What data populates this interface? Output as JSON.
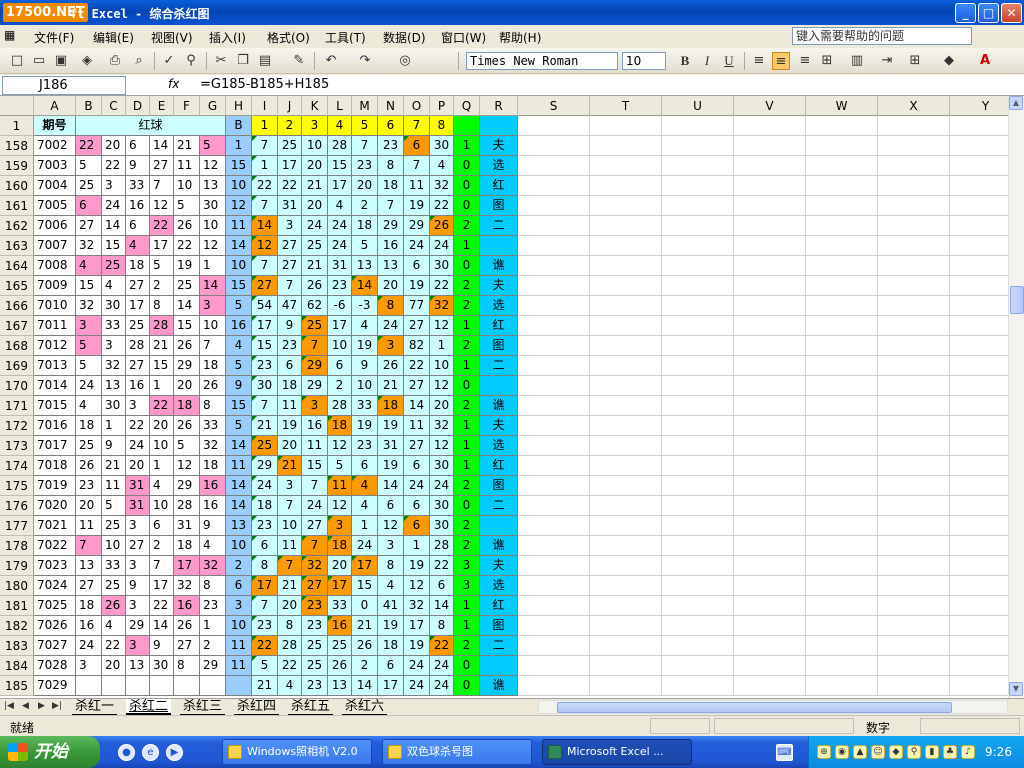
{
  "window": {
    "logo": "17500.NET",
    "title": "ft Excel - 综合杀红图",
    "min": "_",
    "max": "□",
    "close": "✕"
  },
  "menu": [
    "文件(F)",
    "编辑(E)",
    "视图(V)",
    "插入(I)",
    "格式(O)",
    "工具(T)",
    "数据(D)",
    "窗口(W)",
    "帮助(H)"
  ],
  "help_placeholder": "键入需要帮助的问题",
  "font": {
    "family_label": "Times New Roman",
    "size": "10"
  },
  "formula_bar": {
    "name_box": "J186",
    "fx": "fx",
    "formula": "=G185-B185+H185"
  },
  "columns": [
    "A",
    "B",
    "C",
    "D",
    "E",
    "F",
    "G",
    "H",
    "I",
    "J",
    "K",
    "L",
    "M",
    "N",
    "O",
    "P",
    "Q",
    "R",
    "S",
    "T",
    "U",
    "V",
    "W",
    "X",
    "Y"
  ],
  "header_row": {
    "row_num": "1",
    "period_label": "期号",
    "red_label": "红球",
    "blue_label": "B",
    "kill_nums": [
      "1",
      "2",
      "3",
      "4",
      "5",
      "6",
      "7",
      "8"
    ]
  },
  "rows": [
    {
      "n": "158",
      "p": "7002",
      "r": [
        "22",
        "20",
        "6",
        "14",
        "21",
        "5"
      ],
      "b": "1",
      "k": [
        "7",
        "25",
        "10",
        "28",
        "7",
        "23",
        "6",
        "30"
      ],
      "q": "1",
      "t": "夫",
      "hl": [
        0,
        5
      ],
      "or": [
        6
      ]
    },
    {
      "n": "159",
      "p": "7003",
      "r": [
        "5",
        "22",
        "9",
        "27",
        "11",
        "12"
      ],
      "b": "15",
      "k": [
        "1",
        "17",
        "20",
        "15",
        "23",
        "8",
        "7",
        "4"
      ],
      "q": "0",
      "t": "选",
      "hl": [],
      "or": []
    },
    {
      "n": "160",
      "p": "7004",
      "r": [
        "25",
        "3",
        "33",
        "7",
        "10",
        "13"
      ],
      "b": "10",
      "k": [
        "22",
        "22",
        "21",
        "17",
        "20",
        "18",
        "11",
        "32"
      ],
      "q": "0",
      "t": "红",
      "hl": [],
      "or": []
    },
    {
      "n": "161",
      "p": "7005",
      "r": [
        "6",
        "24",
        "16",
        "12",
        "5",
        "30"
      ],
      "b": "12",
      "k": [
        "7",
        "31",
        "20",
        "4",
        "2",
        "7",
        "19",
        "22"
      ],
      "q": "0",
      "t": "图",
      "hl": [
        0
      ],
      "or": []
    },
    {
      "n": "162",
      "p": "7006",
      "r": [
        "27",
        "14",
        "6",
        "22",
        "26",
        "10"
      ],
      "b": "11",
      "k": [
        "14",
        "3",
        "24",
        "24",
        "18",
        "29",
        "29",
        "26"
      ],
      "q": "2",
      "t": "二",
      "hl": [
        3
      ],
      "or": [
        0,
        7
      ]
    },
    {
      "n": "163",
      "p": "7007",
      "r": [
        "32",
        "15",
        "4",
        "17",
        "22",
        "12"
      ],
      "b": "14",
      "k": [
        "12",
        "27",
        "25",
        "24",
        "5",
        "16",
        "24",
        "24"
      ],
      "q": "1",
      "t": "",
      "hl": [
        2
      ],
      "or": [
        0
      ]
    },
    {
      "n": "164",
      "p": "7008",
      "r": [
        "4",
        "25",
        "18",
        "5",
        "19",
        "1"
      ],
      "b": "10",
      "k": [
        "7",
        "27",
        "21",
        "31",
        "13",
        "13",
        "6",
        "30"
      ],
      "q": "0",
      "t": "谯",
      "hl": [
        0,
        1
      ],
      "or": []
    },
    {
      "n": "165",
      "p": "7009",
      "r": [
        "15",
        "4",
        "27",
        "2",
        "25",
        "14"
      ],
      "b": "15",
      "k": [
        "27",
        "7",
        "26",
        "23",
        "14",
        "20",
        "19",
        "22"
      ],
      "q": "2",
      "t": "夫",
      "hl": [
        5
      ],
      "or": [
        0,
        4
      ]
    },
    {
      "n": "166",
      "p": "7010",
      "r": [
        "32",
        "30",
        "17",
        "8",
        "14",
        "3"
      ],
      "b": "5",
      "k": [
        "54",
        "47",
        "62",
        "-6",
        "-3",
        "8",
        "77",
        "32"
      ],
      "q": "2",
      "t": "选",
      "hl": [
        5
      ],
      "or": [
        5,
        7
      ]
    },
    {
      "n": "167",
      "p": "7011",
      "r": [
        "3",
        "33",
        "25",
        "28",
        "15",
        "10"
      ],
      "b": "16",
      "k": [
        "17",
        "9",
        "25",
        "17",
        "4",
        "24",
        "27",
        "12"
      ],
      "q": "1",
      "t": "红",
      "hl": [
        0,
        3
      ],
      "or": [
        2
      ]
    },
    {
      "n": "168",
      "p": "7012",
      "r": [
        "5",
        "3",
        "28",
        "21",
        "26",
        "7"
      ],
      "b": "4",
      "k": [
        "15",
        "23",
        "7",
        "10",
        "19",
        "3",
        "82",
        "1"
      ],
      "q": "2",
      "t": "图",
      "hl": [
        0
      ],
      "or": [
        2,
        5
      ]
    },
    {
      "n": "169",
      "p": "7013",
      "r": [
        "5",
        "32",
        "27",
        "15",
        "29",
        "18"
      ],
      "b": "5",
      "k": [
        "23",
        "6",
        "29",
        "6",
        "9",
        "26",
        "22",
        "10"
      ],
      "q": "1",
      "t": "二",
      "hl": [],
      "or": [
        2
      ]
    },
    {
      "n": "170",
      "p": "7014",
      "r": [
        "24",
        "13",
        "16",
        "1",
        "20",
        "26"
      ],
      "b": "9",
      "k": [
        "30",
        "18",
        "29",
        "2",
        "10",
        "21",
        "27",
        "12"
      ],
      "q": "0",
      "t": "",
      "hl": [],
      "or": []
    },
    {
      "n": "171",
      "p": "7015",
      "r": [
        "4",
        "30",
        "3",
        "22",
        "18",
        "8"
      ],
      "b": "15",
      "k": [
        "7",
        "11",
        "3",
        "28",
        "33",
        "18",
        "14",
        "20"
      ],
      "q": "2",
      "t": "谯",
      "hl": [
        3,
        4
      ],
      "or": [
        2,
        5
      ]
    },
    {
      "n": "172",
      "p": "7016",
      "r": [
        "18",
        "1",
        "22",
        "20",
        "26",
        "33"
      ],
      "b": "5",
      "k": [
        "21",
        "19",
        "16",
        "18",
        "19",
        "19",
        "11",
        "32"
      ],
      "q": "1",
      "t": "夫",
      "hl": [],
      "or": [
        3
      ]
    },
    {
      "n": "173",
      "p": "7017",
      "r": [
        "25",
        "9",
        "24",
        "10",
        "5",
        "32"
      ],
      "b": "14",
      "k": [
        "25",
        "20",
        "11",
        "12",
        "23",
        "31",
        "27",
        "12"
      ],
      "q": "1",
      "t": "选",
      "hl": [],
      "or": [
        0
      ]
    },
    {
      "n": "174",
      "p": "7018",
      "r": [
        "26",
        "21",
        "20",
        "1",
        "12",
        "18"
      ],
      "b": "11",
      "k": [
        "29",
        "21",
        "15",
        "5",
        "6",
        "19",
        "6",
        "30"
      ],
      "q": "1",
      "t": "红",
      "hl": [],
      "or": [
        1
      ]
    },
    {
      "n": "175",
      "p": "7019",
      "r": [
        "23",
        "11",
        "31",
        "4",
        "29",
        "16"
      ],
      "b": "14",
      "k": [
        "24",
        "3",
        "7",
        "11",
        "4",
        "14",
        "24",
        "24"
      ],
      "q": "2",
      "t": "图",
      "hl": [
        2,
        5
      ],
      "or": [
        3,
        4
      ]
    },
    {
      "n": "176",
      "p": "7020",
      "r": [
        "20",
        "5",
        "31",
        "10",
        "28",
        "16"
      ],
      "b": "14",
      "k": [
        "18",
        "7",
        "24",
        "12",
        "4",
        "6",
        "6",
        "30"
      ],
      "q": "0",
      "t": "二",
      "hl": [
        2
      ],
      "or": []
    },
    {
      "n": "177",
      "p": "7021",
      "r": [
        "11",
        "25",
        "3",
        "6",
        "31",
        "9"
      ],
      "b": "13",
      "k": [
        "23",
        "10",
        "27",
        "3",
        "1",
        "12",
        "6",
        "30"
      ],
      "q": "2",
      "t": "",
      "hl": [],
      "or": [
        3,
        6
      ]
    },
    {
      "n": "178",
      "p": "7022",
      "r": [
        "7",
        "10",
        "27",
        "2",
        "18",
        "4"
      ],
      "b": "10",
      "k": [
        "6",
        "11",
        "7",
        "18",
        "24",
        "3",
        "1",
        "28"
      ],
      "q": "2",
      "t": "谯",
      "hl": [
        0
      ],
      "or": [
        2,
        3
      ]
    },
    {
      "n": "179",
      "p": "7023",
      "r": [
        "13",
        "33",
        "3",
        "7",
        "17",
        "32"
      ],
      "b": "2",
      "k": [
        "8",
        "7",
        "32",
        "20",
        "17",
        "8",
        "19",
        "22"
      ],
      "q": "3",
      "t": "夫",
      "hl": [
        4,
        5
      ],
      "or": [
        1,
        2,
        4
      ]
    },
    {
      "n": "180",
      "p": "7024",
      "r": [
        "27",
        "25",
        "9",
        "17",
        "32",
        "8"
      ],
      "b": "6",
      "k": [
        "17",
        "21",
        "27",
        "17",
        "15",
        "4",
        "12",
        "6"
      ],
      "q": "3",
      "t": "选",
      "hl": [],
      "or": [
        0,
        2,
        3
      ]
    },
    {
      "n": "181",
      "p": "7025",
      "r": [
        "18",
        "26",
        "3",
        "22",
        "16",
        "23"
      ],
      "b": "3",
      "k": [
        "7",
        "20",
        "23",
        "33",
        "0",
        "41",
        "32",
        "14"
      ],
      "q": "1",
      "t": "红",
      "hl": [
        1,
        4
      ],
      "or": [
        2
      ]
    },
    {
      "n": "182",
      "p": "7026",
      "r": [
        "16",
        "4",
        "29",
        "14",
        "26",
        "1"
      ],
      "b": "10",
      "k": [
        "23",
        "8",
        "23",
        "16",
        "21",
        "19",
        "17",
        "8"
      ],
      "q": "1",
      "t": "图",
      "hl": [],
      "or": [
        3
      ]
    },
    {
      "n": "183",
      "p": "7027",
      "r": [
        "24",
        "22",
        "3",
        "9",
        "27",
        "2"
      ],
      "b": "11",
      "k": [
        "22",
        "28",
        "25",
        "25",
        "26",
        "18",
        "19",
        "22"
      ],
      "q": "2",
      "t": "二",
      "hl": [
        2
      ],
      "or": [
        0,
        7
      ]
    },
    {
      "n": "184",
      "p": "7028",
      "r": [
        "3",
        "20",
        "13",
        "30",
        "8",
        "29"
      ],
      "b": "11",
      "k": [
        "5",
        "22",
        "25",
        "26",
        "2",
        "6",
        "24",
        "24"
      ],
      "q": "0",
      "t": "",
      "hl": [],
      "or": []
    },
    {
      "n": "185",
      "p": "7029",
      "r": [
        "",
        "",
        "",
        "",
        "",
        ""
      ],
      "b": "",
      "k": [
        "21",
        "4",
        "23",
        "13",
        "14",
        "17",
        "24",
        "24"
      ],
      "q": "0",
      "t": "谯",
      "hl": [],
      "or": []
    }
  ],
  "sheet_tabs": [
    "杀红一",
    "杀红二",
    "杀红三",
    "杀红四",
    "杀红五",
    "杀红六"
  ],
  "active_tab": 1,
  "status": {
    "ready": "就绪",
    "num": "数字"
  },
  "taskbar": {
    "start": "开始",
    "tasks": [
      "Windows照相机 V2.0",
      "双色球杀号图",
      "Microsoft Excel ..."
    ],
    "clock": "9:26"
  },
  "colors": {
    "pink": "#ff99cc",
    "orange": "#ff9900",
    "light_teal": "#ccffff",
    "blue": "#99ccff",
    "green": "#00ff00",
    "yellow": "#ffff00",
    "cyan": "#00ccff"
  }
}
